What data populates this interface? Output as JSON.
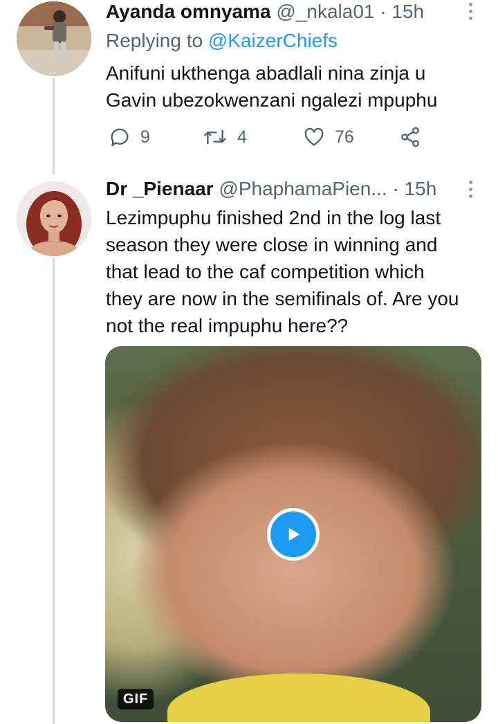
{
  "tweets": [
    {
      "author_name": "Ayanda omnyama",
      "handle": "@_nkala01",
      "time": "· 15h",
      "replying_label": "Replying to ",
      "replying_handle": "@KaizerChiefs",
      "text": "Anifuni ukthenga abadlali nina zinja u\nGavin ubezokwenzani ngalezi mpuphu",
      "replies": "9",
      "retweets": "4",
      "likes": "76",
      "icons": [
        "reply-icon",
        "retweet-icon",
        "like-icon",
        "share-icon",
        "more-icon"
      ]
    },
    {
      "author_name": "Dr _Pienaar",
      "handle": "@PhaphamaPien...",
      "time": "· 15h",
      "text": "Lezimpuphu finished 2nd in the log last\nseason they were close in winning and\nthat lead to the caf competition which\nthey are now in the semifinals of. Are you\nnot the real impuphu here??",
      "media": {
        "badge": "GIF",
        "icons": [
          "play-icon"
        ]
      }
    }
  ],
  "colors": {
    "accent": "#1d9bf0",
    "text": "#0f1419",
    "muted": "#536471",
    "thread_line": "#cfd9de"
  }
}
